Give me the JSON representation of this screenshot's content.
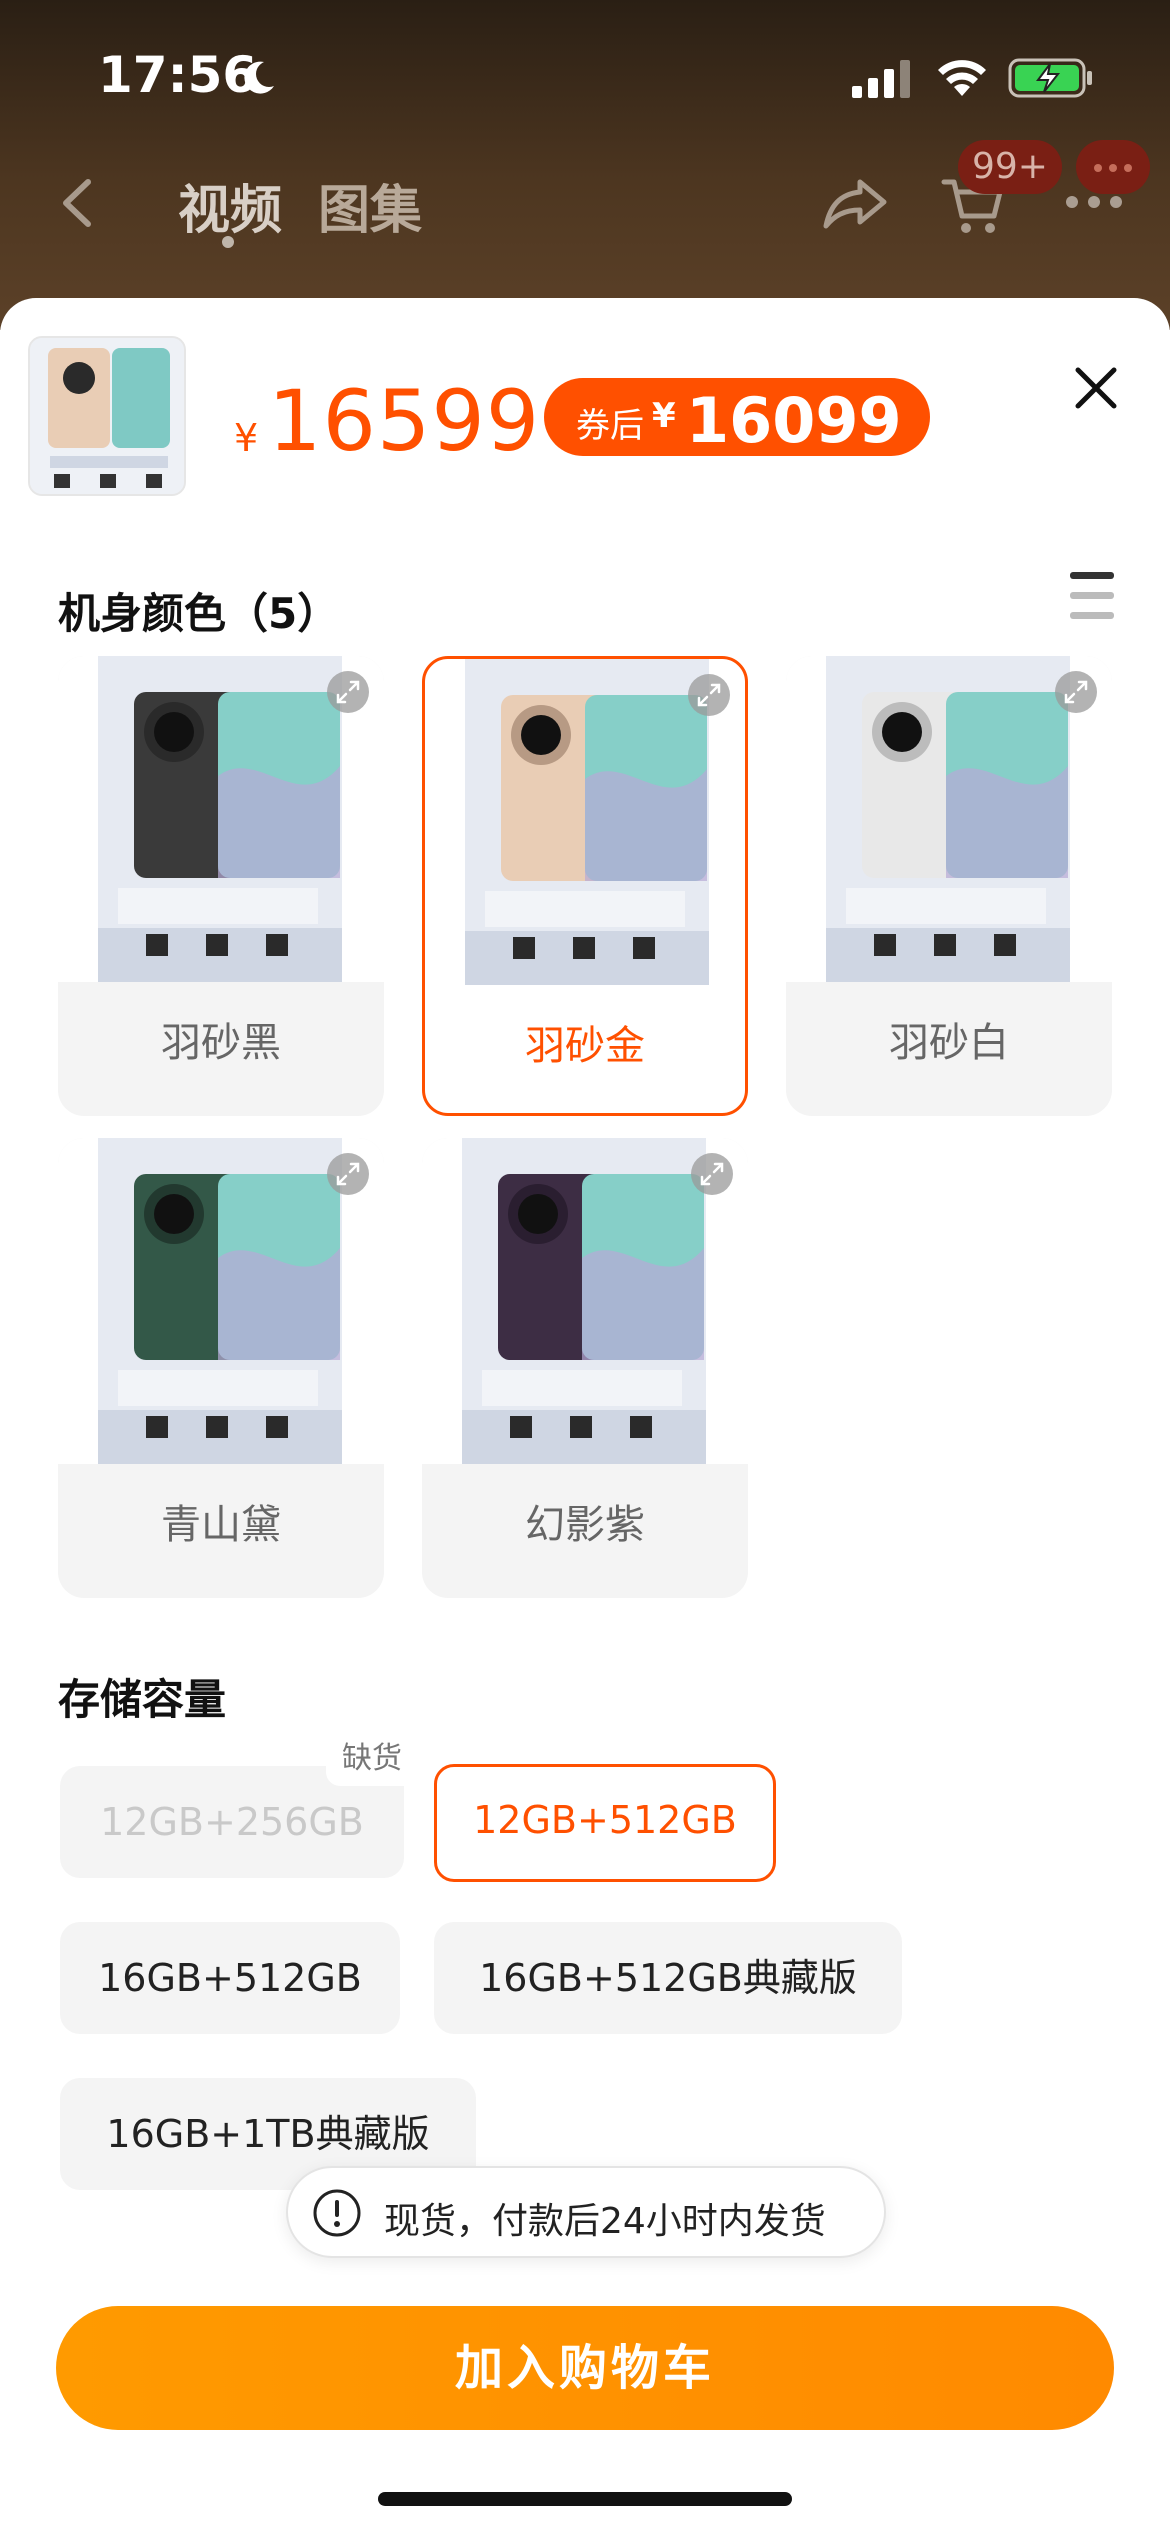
{
  "status_bar": {
    "time": "17:56"
  },
  "nav": {
    "tabs": [
      {
        "label": "视频"
      },
      {
        "label": "图集"
      }
    ],
    "cart_badge": "99+"
  },
  "product": {
    "price": {
      "currency": "¥",
      "value": "16599"
    },
    "coupon": {
      "label": "券后",
      "currency": "¥",
      "value": "16099"
    }
  },
  "color_section": {
    "title": "机身颜色（5）",
    "options": [
      {
        "label": "羽砂黑",
        "selected": false,
        "phone_color": "#3a3a3a",
        "ring": "#2a2a2a"
      },
      {
        "label": "羽砂金",
        "selected": true,
        "phone_color": "#e9cdb5",
        "ring": "#b79a84"
      },
      {
        "label": "羽砂白",
        "selected": false,
        "phone_color": "#e8e8e8",
        "ring": "#bcbcbc"
      },
      {
        "label": "青山黛",
        "selected": false,
        "phone_color": "#335848",
        "ring": "#22392f"
      },
      {
        "label": "幻影紫",
        "selected": false,
        "phone_color": "#3d2d44",
        "ring": "#2a1e30"
      }
    ]
  },
  "storage_section": {
    "title": "存储容量",
    "out_of_stock_badge": "缺货",
    "options": [
      {
        "label": "12GB+256GB",
        "state": "disabled"
      },
      {
        "label": "12GB+512GB",
        "state": "selected"
      },
      {
        "label": "16GB+512GB",
        "state": "normal"
      },
      {
        "label": "16GB+512GB典藏版",
        "state": "normal"
      },
      {
        "label": "16GB+1TB典藏版",
        "state": "normal"
      }
    ]
  },
  "notice": {
    "text": "现货，付款后24小时内发货"
  },
  "cta": {
    "label": "加入购物车"
  },
  "colors": {
    "accent": "#ff5000",
    "cta": "#ff8c00"
  }
}
